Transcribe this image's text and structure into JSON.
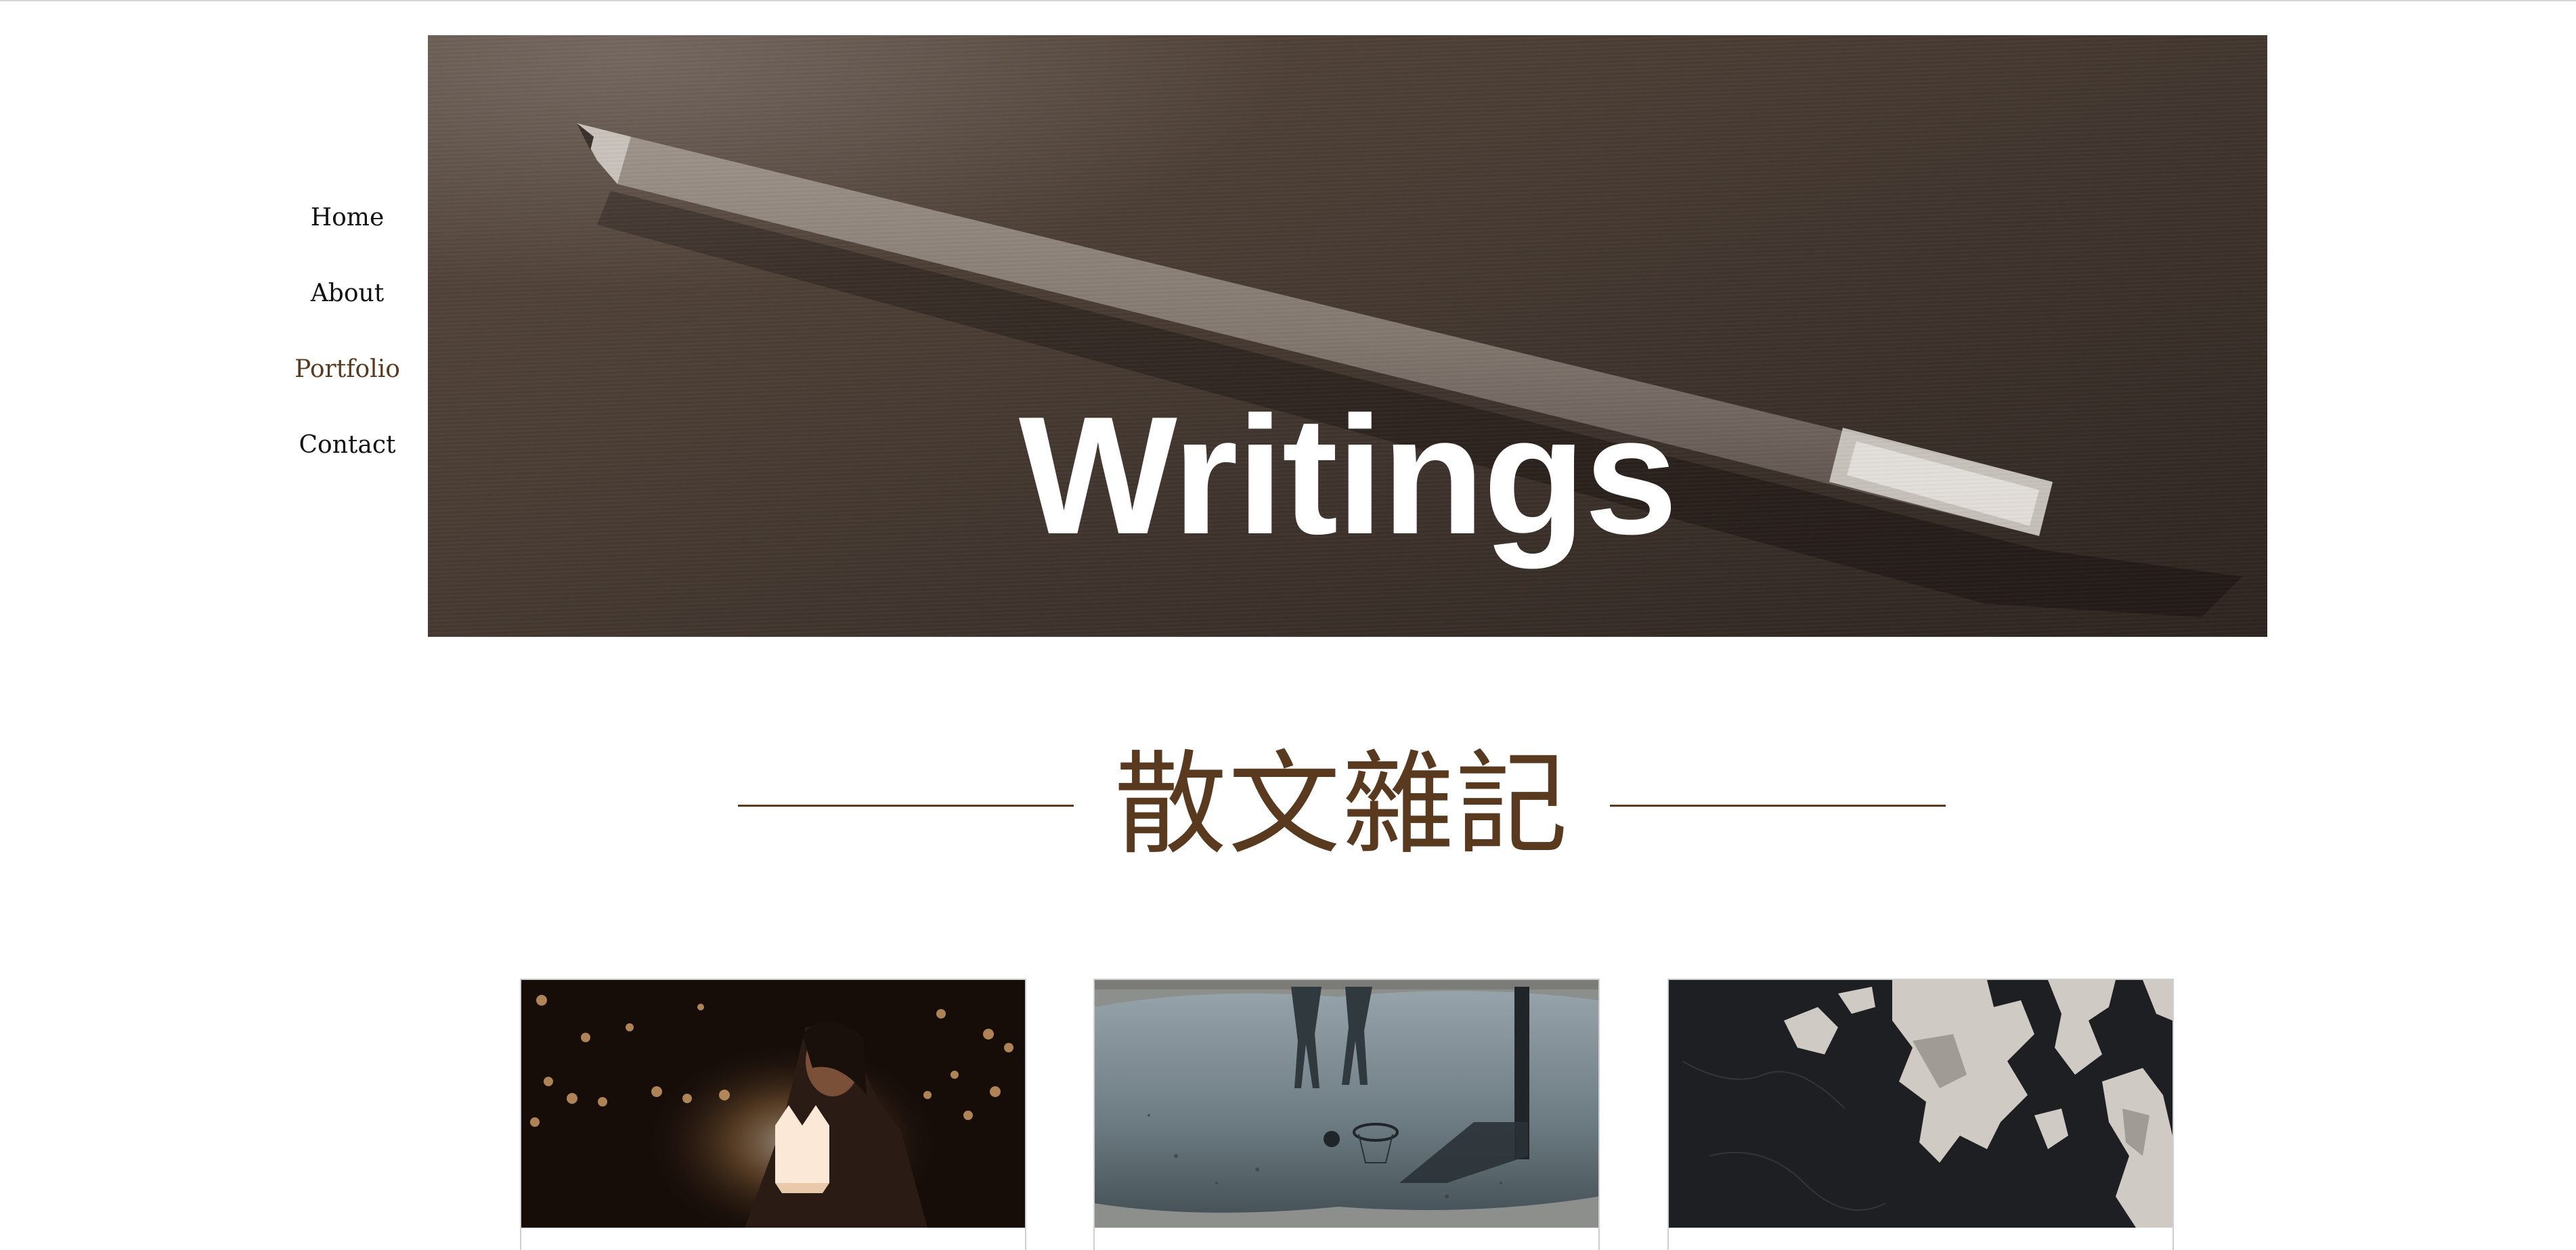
{
  "nav": {
    "items": [
      {
        "label": "Home",
        "active": false
      },
      {
        "label": "About",
        "active": false
      },
      {
        "label": "Portfolio",
        "active": true
      },
      {
        "label": "Contact",
        "active": false
      }
    ]
  },
  "hero": {
    "title": "Writings"
  },
  "section": {
    "heading": "散文雜記"
  },
  "cards": [
    {
      "image": "woman-holding-paper-lantern-photo"
    },
    {
      "image": "basketball-hoop-puddle-reflection-photo"
    },
    {
      "image": "peeling-paint-texture-photo"
    }
  ],
  "colors": {
    "accent": "#5a3a1e",
    "nav_text": "#111111",
    "background": "#ffffff"
  }
}
